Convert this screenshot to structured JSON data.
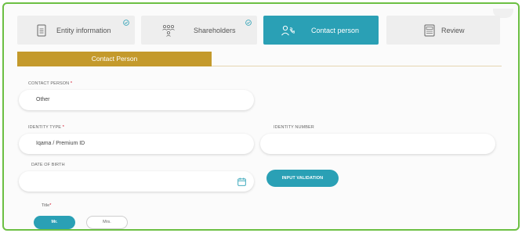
{
  "colors": {
    "accent": "#2aa0b5",
    "section_bar": "#c49a2c",
    "frame_border": "#6cbf43",
    "required": "#d0021b"
  },
  "steps": [
    {
      "label": "Entity information",
      "icon": "document-icon",
      "completed": true,
      "active": false
    },
    {
      "label": "Shareholders",
      "icon": "people-icon",
      "completed": true,
      "active": false
    },
    {
      "label": "Contact person",
      "icon": "contact-person-icon",
      "completed": false,
      "active": true
    },
    {
      "label": "Review",
      "icon": "review-icon",
      "completed": false,
      "active": false
    }
  ],
  "section": {
    "title": "Contact Person"
  },
  "form": {
    "contact_person": {
      "label": "CONTACT PERSON",
      "required_mark": "*",
      "value": "Other"
    },
    "identity_type": {
      "label": "IDENTITY TYPE",
      "required_mark": "*",
      "value": "Iqama / Premium ID"
    },
    "identity_number": {
      "label": "IDENTITY NUMBER",
      "value": ""
    },
    "date_of_birth": {
      "label": "DATE OF BIRTH",
      "value": "",
      "icon": "calendar-icon"
    },
    "validate_button": "INPUT VALIDATION",
    "title": {
      "label": "Title",
      "required_mark": "*",
      "options": [
        "Mr.",
        "Mrs."
      ],
      "selected": "Mr."
    }
  }
}
